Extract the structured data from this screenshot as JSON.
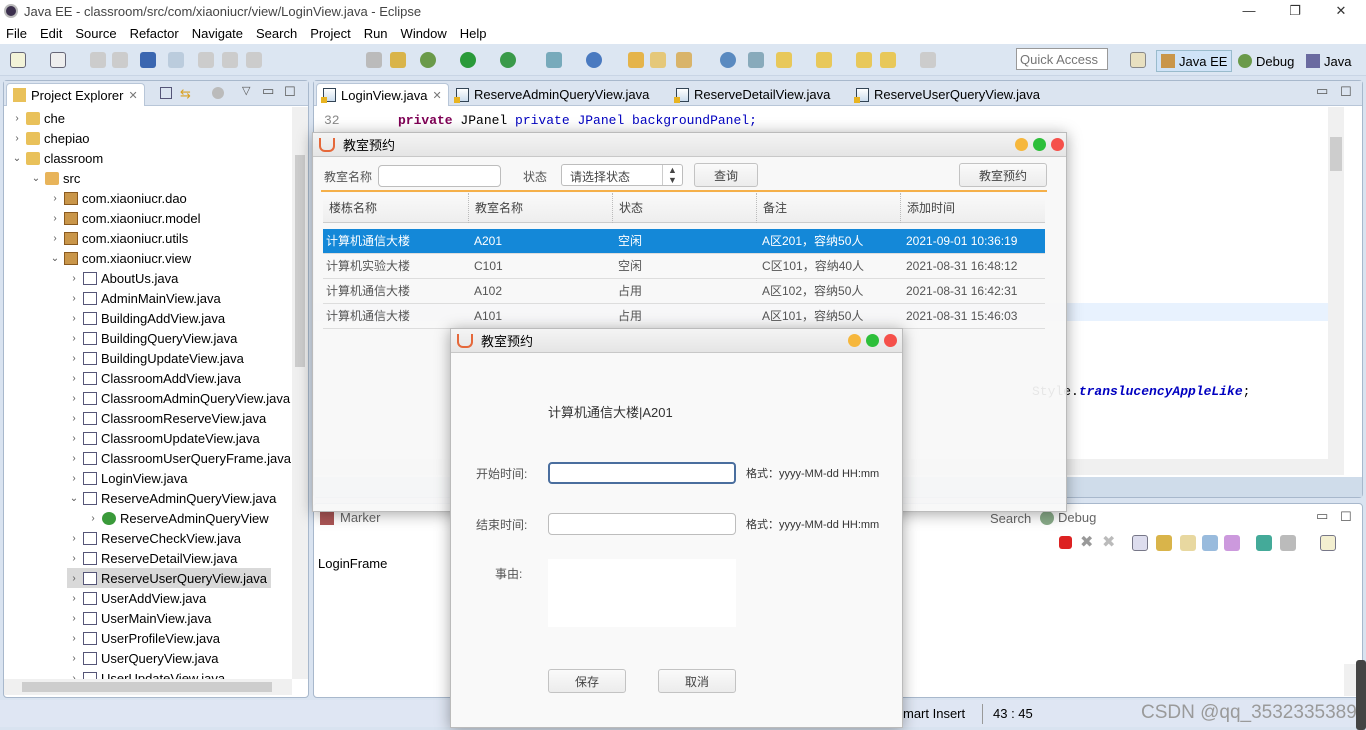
{
  "window": {
    "title": "Java EE - classroom/src/com/xiaoniucr/view/LoginView.java - Eclipse",
    "controls": [
      "—",
      "❐",
      "✕"
    ]
  },
  "menu": [
    "File",
    "Edit",
    "Source",
    "Refactor",
    "Navigate",
    "Search",
    "Project",
    "Run",
    "Window",
    "Help"
  ],
  "toolbar": {
    "quick_access_placeholder": "Quick Access",
    "perspectives": [
      "Java EE",
      "Debug",
      "Java"
    ],
    "accent": "#dce6f2"
  },
  "project_explorer": {
    "title": "Project Explorer",
    "items": [
      {
        "label": "che",
        "depth": 0,
        "icon": "folder",
        "arrow": "right"
      },
      {
        "label": "chepiao",
        "depth": 0,
        "icon": "folder",
        "arrow": "right"
      },
      {
        "label": "classroom",
        "depth": 0,
        "icon": "folder",
        "arrow": "down"
      },
      {
        "label": "src",
        "depth": 1,
        "icon": "src",
        "arrow": "down"
      },
      {
        "label": "com.xiaoniucr.dao",
        "depth": 2,
        "icon": "pkg",
        "arrow": "right"
      },
      {
        "label": "com.xiaoniucr.model",
        "depth": 2,
        "icon": "pkg",
        "arrow": "right"
      },
      {
        "label": "com.xiaoniucr.utils",
        "depth": 2,
        "icon": "pkg",
        "arrow": "right"
      },
      {
        "label": "com.xiaoniucr.view",
        "depth": 2,
        "icon": "pkg",
        "arrow": "down"
      },
      {
        "label": "AboutUs.java",
        "depth": 3,
        "icon": "java",
        "arrow": "right"
      },
      {
        "label": "AdminMainView.java",
        "depth": 3,
        "icon": "java",
        "arrow": "right"
      },
      {
        "label": "BuildingAddView.java",
        "depth": 3,
        "icon": "java",
        "arrow": "right"
      },
      {
        "label": "BuildingQueryView.java",
        "depth": 3,
        "icon": "java",
        "arrow": "right"
      },
      {
        "label": "BuildingUpdateView.java",
        "depth": 3,
        "icon": "java",
        "arrow": "right"
      },
      {
        "label": "ClassroomAddView.java",
        "depth": 3,
        "icon": "java",
        "arrow": "right"
      },
      {
        "label": "ClassroomAdminQueryView.java",
        "depth": 3,
        "icon": "java",
        "arrow": "right"
      },
      {
        "label": "ClassroomReserveView.java",
        "depth": 3,
        "icon": "java",
        "arrow": "right"
      },
      {
        "label": "ClassroomUpdateView.java",
        "depth": 3,
        "icon": "java",
        "arrow": "right"
      },
      {
        "label": "ClassroomUserQueryFrame.java",
        "depth": 3,
        "icon": "java",
        "arrow": "right"
      },
      {
        "label": "LoginView.java",
        "depth": 3,
        "icon": "java",
        "arrow": "right"
      },
      {
        "label": "ReserveAdminQueryView.java",
        "depth": 3,
        "icon": "java",
        "arrow": "down"
      },
      {
        "label": "ReserveAdminQueryView",
        "depth": 4,
        "icon": "cls",
        "arrow": "right"
      },
      {
        "label": "ReserveCheckView.java",
        "depth": 3,
        "icon": "java",
        "arrow": "right"
      },
      {
        "label": "ReserveDetailView.java",
        "depth": 3,
        "icon": "java",
        "arrow": "right"
      },
      {
        "label": "ReserveUserQueryView.java",
        "depth": 3,
        "icon": "java",
        "arrow": "right",
        "selected": true
      },
      {
        "label": "UserAddView.java",
        "depth": 3,
        "icon": "java",
        "arrow": "right"
      },
      {
        "label": "UserMainView.java",
        "depth": 3,
        "icon": "java",
        "arrow": "right"
      },
      {
        "label": "UserProfileView.java",
        "depth": 3,
        "icon": "java",
        "arrow": "right"
      },
      {
        "label": "UserQueryView.java",
        "depth": 3,
        "icon": "java",
        "arrow": "right"
      },
      {
        "label": "UserUpdateView.java",
        "depth": 3,
        "icon": "java",
        "arrow": "right"
      }
    ]
  },
  "editor": {
    "tabs": [
      "LoginView.java",
      "ReserveAdminQueryView.java",
      "ReserveDetailView.java",
      "ReserveUserQueryView.java"
    ],
    "line_number": "32",
    "code_line": "private JPanel backgroundPanel;",
    "code_fragment_plain": "Style.",
    "code_fragment_field": "translucencyAppleLike",
    "code_fragment_end": ";"
  },
  "bottom_panel": {
    "tabs": [
      "Marker",
      "Search",
      "Debug"
    ],
    "console_label": "LoginFrame"
  },
  "status_bar": {
    "insert_mode": "mart Insert",
    "position": "43 : 45"
  },
  "watermark": "CSDN @qq_3532335389",
  "list_dialog": {
    "title": "教室预约",
    "name_label": "教室名称",
    "name_value": "",
    "status_label": "状态",
    "status_placeholder": "请选择状态",
    "query_button": "查询",
    "reserve_button": "教室预约",
    "columns": [
      "楼栋名称",
      "教室名称",
      "状态",
      "备注",
      "添加时间"
    ],
    "rows": [
      [
        "计算机通信大楼",
        "A201",
        "空闲",
        "A区201，容纳50人",
        "2021-09-01 10:36:19"
      ],
      [
        "计算机实验大楼",
        "C101",
        "空闲",
        "C区101，容纳40人",
        "2021-08-31 16:48:12"
      ],
      [
        "计算机通信大楼",
        "A102",
        "占用",
        "A区102，容纳50人",
        "2021-08-31 16:42:31"
      ],
      [
        "计算机通信大楼",
        "A101",
        "占用",
        "A区101，容纳50人",
        "2021-08-31 15:46:03"
      ]
    ],
    "selected_color": "#1488d8",
    "accent": "#f5b04a"
  },
  "reserve_dialog": {
    "title": "教室预约",
    "room": "计算机通信大楼|A201",
    "start_label": "开始时间:",
    "start_value": "",
    "end_label": "结束时间:",
    "end_value": "",
    "format_hint": "格式：yyyy-MM-dd HH:mm",
    "reason_label": "事由:",
    "reason_value": "",
    "save_button": "保存",
    "cancel_button": "取消"
  }
}
